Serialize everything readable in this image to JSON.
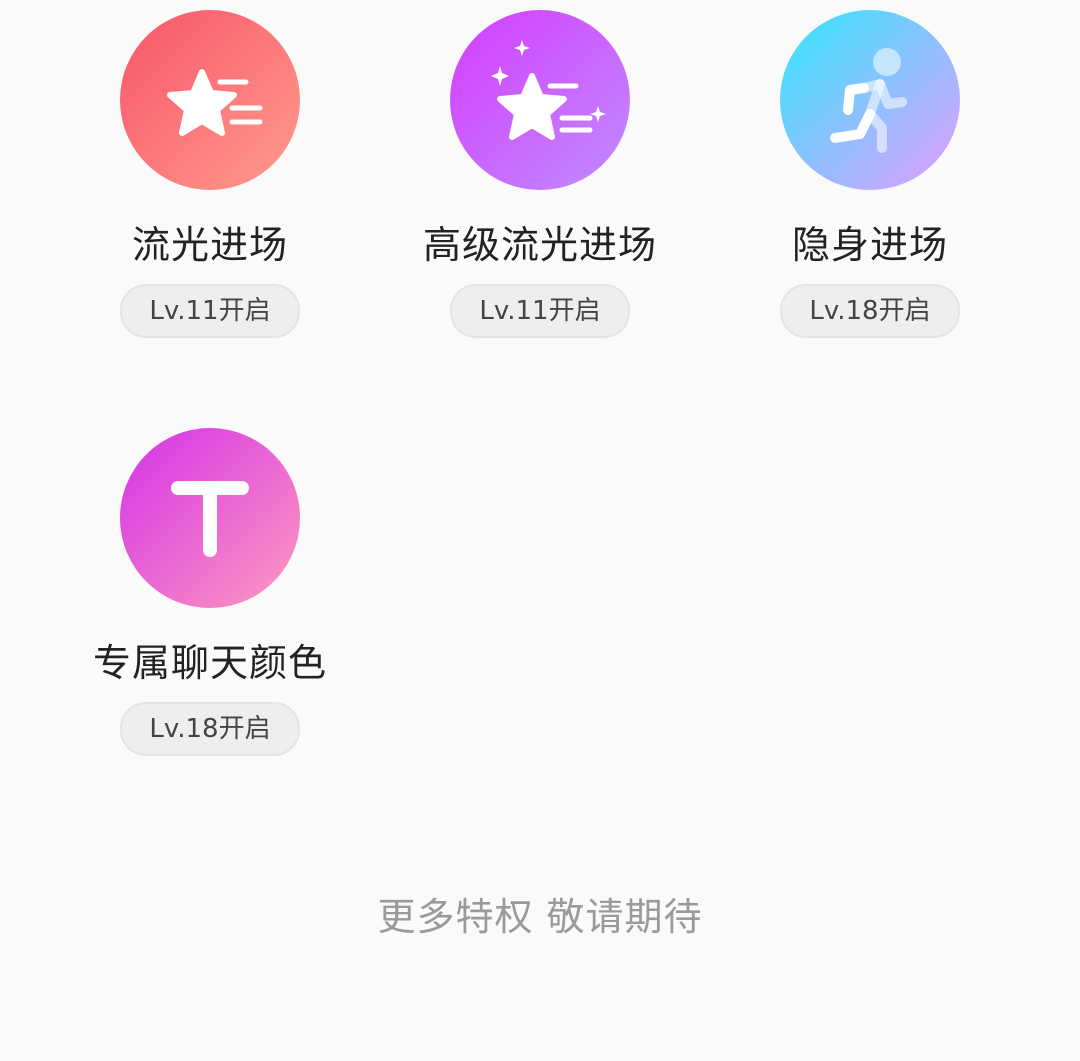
{
  "privileges": [
    {
      "title": "流光进场",
      "badge": "Lv.11开启",
      "icon": "star-flow-icon",
      "gradient": [
        "#f9626f",
        "#ff9a8a"
      ]
    },
    {
      "title": "高级流光进场",
      "badge": "Lv.11开启",
      "icon": "star-sparkle-icon",
      "gradient": [
        "#d23cff",
        "#c48cff"
      ]
    },
    {
      "title": "隐身进场",
      "badge": "Lv.18开启",
      "icon": "running-person-icon",
      "gradient": [
        "#2ee6ff",
        "#e0a0ff"
      ]
    },
    {
      "title": "专属聊天颜色",
      "badge": "Lv.18开启",
      "icon": "text-t-icon",
      "gradient": [
        "#d63ae8",
        "#ff94bf"
      ]
    }
  ],
  "footer": "更多特权 敬请期待"
}
